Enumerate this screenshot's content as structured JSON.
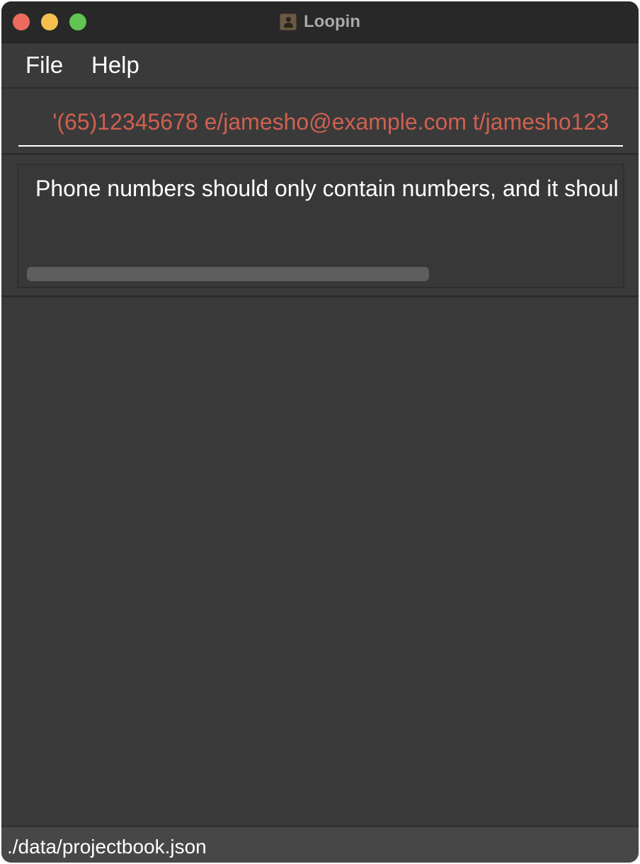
{
  "window": {
    "title": "Loopin"
  },
  "menu": {
    "file": "File",
    "help": "Help"
  },
  "command_box": {
    "value": "'(65)12345678 e/jamesho@example.com t/jamesho123",
    "text_color": "#d0604f"
  },
  "result_display": {
    "message": "Phone numbers should only contain numbers, and it shoul"
  },
  "status_bar": {
    "path": "./data/projectbook.json"
  },
  "icons": {
    "app_icon": "contact-book-icon"
  }
}
